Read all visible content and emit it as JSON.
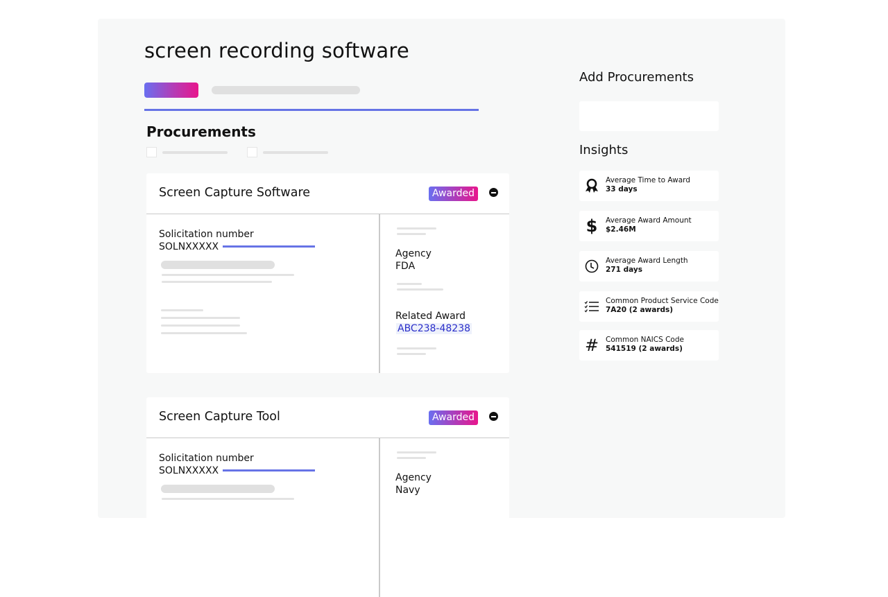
{
  "page": {
    "title": "screen recording software",
    "section_title": "Procurements"
  },
  "colors": {
    "accent": "#6673e6",
    "gradient_start": "#6a6ff0",
    "gradient_end": "#e8168c",
    "link": "#2a2ec9",
    "panel_bg": "#f7f8f8"
  },
  "procurements": [
    {
      "title": "Screen Capture Software",
      "status": "Awarded",
      "solicitation_label": "Solicitation number",
      "solicitation_value": "SOLNXXXXX",
      "agency_label": "Agency",
      "agency_value": "FDA",
      "related_award_label": "Related Award",
      "related_award_value": "ABC238-48238"
    },
    {
      "title": "Screen Capture Tool",
      "status": "Awarded",
      "solicitation_label": "Solicitation number",
      "solicitation_value": "SOLNXXXXX",
      "agency_label": "Agency",
      "agency_value": "Navy"
    }
  ],
  "sidebar": {
    "add_title": "Add Procurements",
    "insights_title": "Insights",
    "insights": [
      {
        "icon": "award-ribbon-icon",
        "label": "Average Time to Award",
        "value": "33 days"
      },
      {
        "icon": "dollar-icon",
        "label": "Average Award Amount",
        "value": "$2.46M"
      },
      {
        "icon": "clock-icon",
        "label": "Average Award Length",
        "value": "271 days"
      },
      {
        "icon": "checklist-icon",
        "label": "Common Product Service Code",
        "value": "7A20 (2 awards)"
      },
      {
        "icon": "hash-icon",
        "label": "Common NAICS Code",
        "value": "541519 (2 awards)"
      }
    ]
  }
}
